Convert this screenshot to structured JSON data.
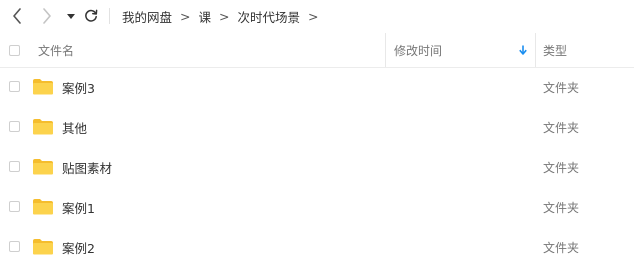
{
  "toolbar": {
    "back_icon": "chevron-left-icon",
    "forward_icon": "chevron-right-icon",
    "history_icon": "caret-down-icon",
    "refresh_icon": "refresh-icon"
  },
  "breadcrumb": {
    "items": [
      "我的网盘",
      "课",
      "次时代场景"
    ],
    "separator": ">"
  },
  "table": {
    "columns": {
      "name": "文件名",
      "modified": "修改时间",
      "type": "类型"
    },
    "sort_icon": "arrow-down-icon",
    "sort_color": "#1a8ef0",
    "folder_color": "#fcd34d",
    "rows": [
      {
        "name": "案例3",
        "type": "文件夹"
      },
      {
        "name": "其他",
        "type": "文件夹"
      },
      {
        "name": "贴图素材",
        "type": "文件夹"
      },
      {
        "name": "案例1",
        "type": "文件夹"
      },
      {
        "name": "案例2",
        "type": "文件夹"
      }
    ]
  }
}
